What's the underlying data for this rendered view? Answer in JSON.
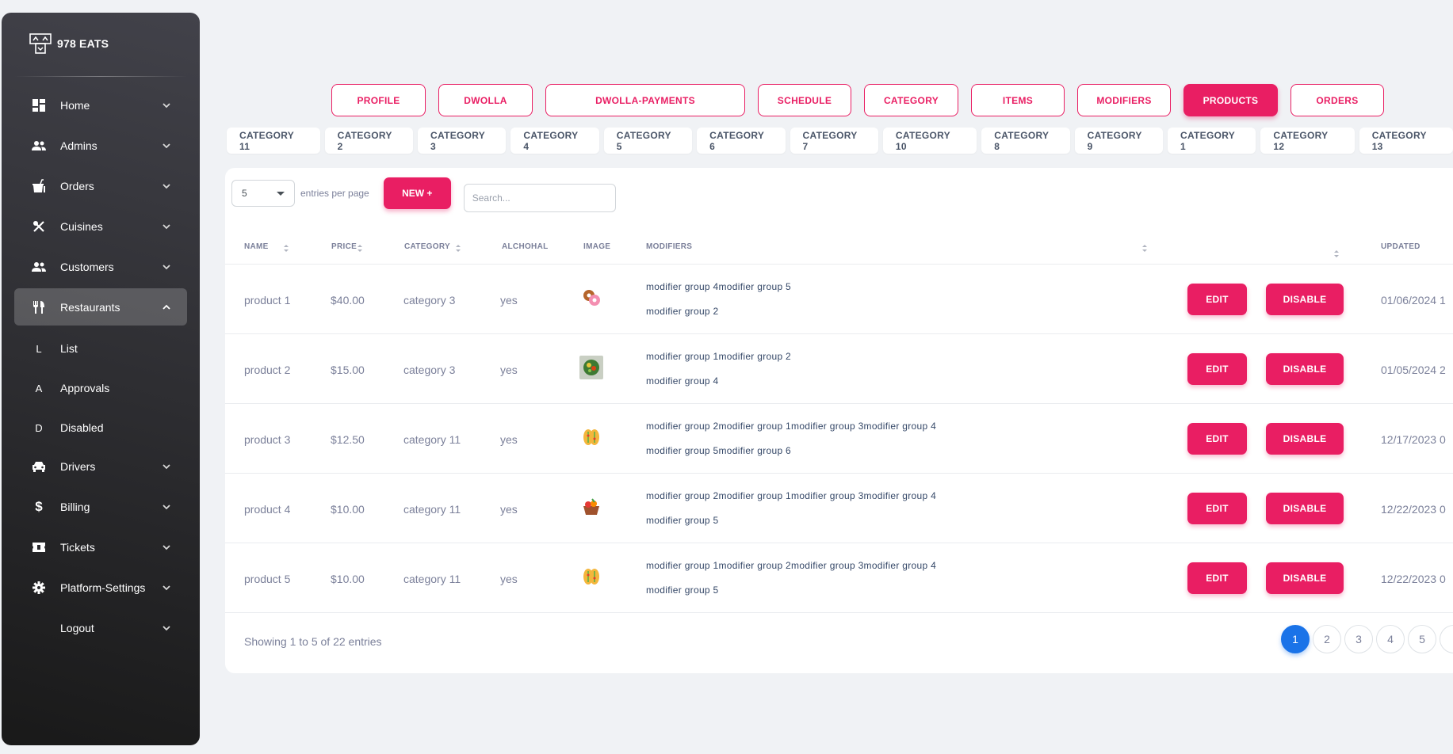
{
  "brand": {
    "name": "978 EATS"
  },
  "sidebar": {
    "items": [
      {
        "label": "Home",
        "icon": "dashboard-icon",
        "chevron": "down"
      },
      {
        "label": "Admins",
        "icon": "people-icon",
        "chevron": "down"
      },
      {
        "label": "Orders",
        "icon": "takeout-icon",
        "chevron": "down"
      },
      {
        "label": "Cuisines",
        "icon": "utensils-crossed-icon",
        "chevron": "down"
      },
      {
        "label": "Customers",
        "icon": "people-icon",
        "chevron": "down"
      },
      {
        "label": "Restaurants",
        "icon": "restaurant-icon",
        "chevron": "up",
        "active": true
      },
      {
        "label": "List",
        "letter": "L"
      },
      {
        "label": "Approvals",
        "letter": "A"
      },
      {
        "label": "Disabled",
        "letter": "D"
      },
      {
        "label": "Drivers",
        "icon": "car-icon",
        "chevron": "down"
      },
      {
        "label": "Billing",
        "icon": "dollar-icon",
        "chevron": "down"
      },
      {
        "label": "Tickets",
        "icon": "ticket-icon",
        "chevron": "down"
      },
      {
        "label": "Platform-Settings",
        "icon": "gear-icon",
        "chevron": "down"
      },
      {
        "label": "Logout",
        "chevron": "down"
      }
    ]
  },
  "top_tabs": [
    "PROFILE",
    "DWOLLA",
    "DWOLLA-PAYMENTS",
    "SCHEDULE",
    "CATEGORY",
    "ITEMS",
    "MODIFIERS",
    "PRODUCTS",
    "ORDERS"
  ],
  "top_tabs_active": "PRODUCTS",
  "category_tabs": [
    "CATEGORY 11",
    "CATEGORY 2",
    "CATEGORY 3",
    "CATEGORY 4",
    "CATEGORY 5",
    "CATEGORY 6",
    "CATEGORY 7",
    "CATEGORY 10",
    "CATEGORY 8",
    "CATEGORY 9",
    "CATEGORY 1",
    "CATEGORY 12",
    "CATEGORY 13"
  ],
  "controls": {
    "entries_value": "5",
    "entries_label": "entries per page",
    "new_button": "NEW +",
    "search_placeholder": "Search..."
  },
  "table": {
    "headers": [
      "NAME",
      "PRICE",
      "CATEGORY",
      "ALCHOHAL",
      "IMAGE",
      "MODIFIERS",
      "UPDATED"
    ],
    "edit_label": "EDIT",
    "disable_label": "DISABLE",
    "rows": [
      {
        "name": "product 1",
        "price": "$40.00",
        "category": "category 3",
        "alcohol": "yes",
        "image": "donut-icon",
        "mod1": "modifier group 4modifier group 5",
        "mod2": "modifier group 2",
        "updated": "01/06/2024 1"
      },
      {
        "name": "product 2",
        "price": "$15.00",
        "category": "category 3",
        "alcohol": "yes",
        "image": "salad-bowl-icon",
        "mod1": "modifier group 1modifier group 2",
        "mod2": "modifier group 4",
        "updated": "01/05/2024 2"
      },
      {
        "name": "product 3",
        "price": "$12.50",
        "category": "category 11",
        "alcohol": "yes",
        "image": "tacos-icon",
        "mod1": "modifier group 2modifier group 1modifier group 3modifier group 4",
        "mod2": "modifier group 5modifier group 6",
        "updated": "12/17/2023 0"
      },
      {
        "name": "product 4",
        "price": "$10.00",
        "category": "category 11",
        "alcohol": "yes",
        "image": "basket-icon",
        "mod1": "modifier group 2modifier group 1modifier group 3modifier group 4",
        "mod2": "modifier group 5",
        "updated": "12/22/2023 0"
      },
      {
        "name": "product 5",
        "price": "$10.00",
        "category": "category 11",
        "alcohol": "yes",
        "image": "tacos-icon",
        "mod1": "modifier group 1modifier group 2modifier group 3modifier group 4",
        "mod2": "modifier group 5",
        "updated": "12/22/2023 0"
      }
    ]
  },
  "footer": {
    "showing": "Showing 1 to 5 of 22 entries",
    "pages": [
      "1",
      "2",
      "3",
      "4",
      "5"
    ],
    "active_page": "1"
  },
  "colors": {
    "accent": "#e91e63",
    "pager_active": "#1a73e8"
  }
}
